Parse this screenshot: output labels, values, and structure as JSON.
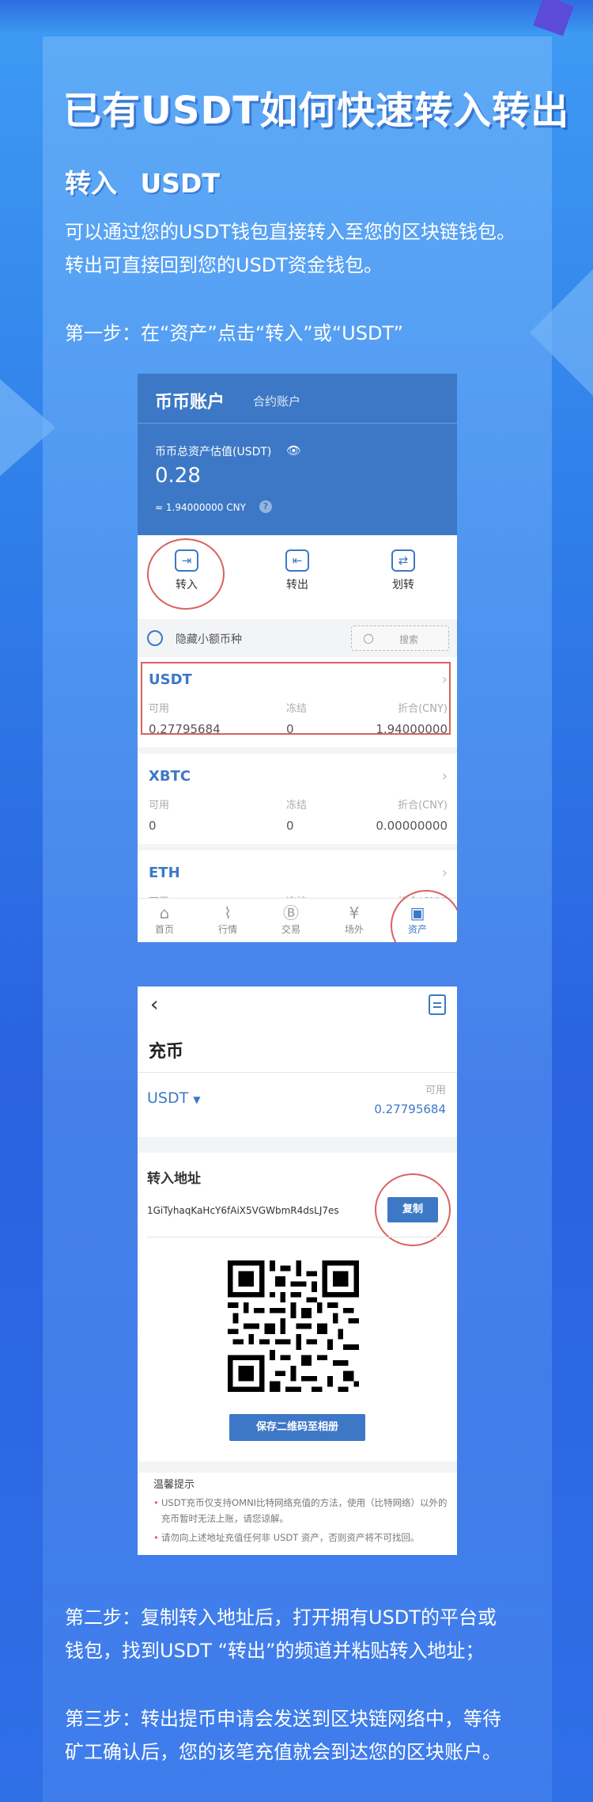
{
  "page": {
    "title": "已有USDT如何快速转入转出",
    "subtitle": "转入 USDT",
    "intro": [
      "可以通过您的USDT钱包直接转入至您的区块链钱包。",
      "转出可直接回到您的USDT资金钱包。"
    ],
    "step1": "第一步：在“资产”点击“转入”或“USDT”",
    "step2": [
      "第二步：复制转入地址后，打开拥有USDT的平台或",
      "钱包，找到USDT “转出”的频道并粘贴转入地址；"
    ],
    "step3": [
      "第三步：转出提币申请会发送到区块链网络中，等待",
      "矿工确认后，您的该笔充值就会到达您的区块账户。"
    ]
  },
  "assets_screen": {
    "tab_main": "币币账户",
    "tab_sub": "合约账户",
    "total_label": "币币总资产估值(USDT)",
    "total_value": "0.28",
    "cny_value": "≈ 1.94000000 CNY",
    "actions": [
      {
        "label": "转入",
        "icon": "wallet-in-icon"
      },
      {
        "label": "转出",
        "icon": "wallet-out-icon"
      },
      {
        "label": "划转",
        "icon": "transfer-icon"
      }
    ],
    "hide_small": "隐藏小额币种",
    "search_placeholder": "搜索",
    "col_headers": [
      "可用",
      "冻结",
      "折合(CNY)"
    ],
    "coins": [
      {
        "name": "USDT",
        "available": "0.27795684",
        "frozen": "0",
        "cny": "1.94000000"
      },
      {
        "name": "XBTC",
        "available": "0",
        "frozen": "0",
        "cny": "0.00000000"
      },
      {
        "name": "ETH",
        "available": "",
        "frozen": "",
        "cny": ""
      }
    ],
    "tabbar": [
      "首页",
      "行情",
      "交易",
      "场外",
      "资产"
    ]
  },
  "deposit_screen": {
    "title": "充币",
    "coin": "USDT",
    "available_label": "可用",
    "available_value": "0.27795684",
    "address_title": "转入地址",
    "address": "1GiTyhaqKaHcY6fAiX5VGWbmR4dsLJ7es",
    "copy_label": "复制",
    "save_qr_label": "保存二维码至相册",
    "tips_title": "温馨提示",
    "tips": [
      "USDT充币仅支持OMNI比特网络充值的方法，使用（比特网络）以外的充币暂时无法上账，请您谅解。",
      "请勿向上述地址充值任何非 USDT 资产，否则资产将不可找回。"
    ]
  },
  "colors": {
    "accent": "#3d78c6",
    "highlight": "#d9625e"
  }
}
